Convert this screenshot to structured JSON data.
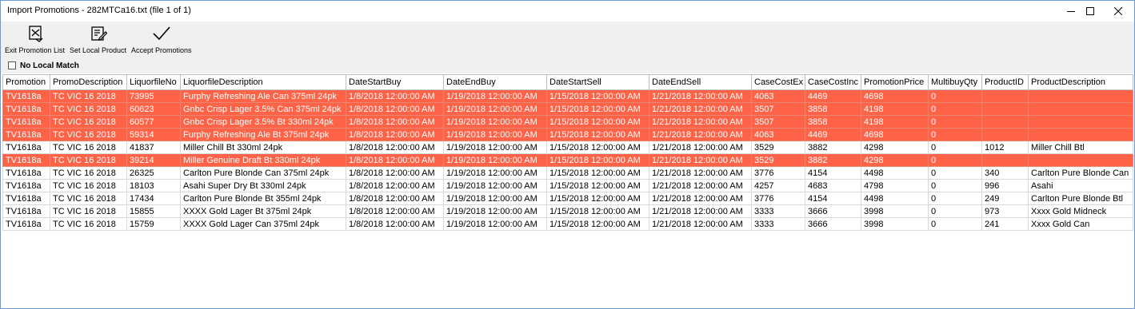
{
  "window": {
    "title": "Import Promotions - 282MTCa16.txt (file 1 of 1)"
  },
  "toolbar": {
    "exit_label": "Exit Promotion List",
    "set_local_label": "Set Local Product",
    "accept_label": "Accept Promotions"
  },
  "filter": {
    "no_local_match_label": "No Local Match",
    "checked": false
  },
  "colors": {
    "highlight_row": "#ff6347",
    "window_border": "#6b9bd1",
    "toolbar_bg": "#f0f0f0"
  },
  "grid": {
    "columns": [
      "Promotion",
      "PromoDescription",
      "LiquorfileNo",
      "LiquorfileDescription",
      "DateStartBuy",
      "DateEndBuy",
      "DateStartSell",
      "DateEndSell",
      "CaseCostEx",
      "CaseCostInc",
      "PromotionPrice",
      "MultibuyQty",
      "ProductID",
      "ProductDescription"
    ],
    "rows": [
      {
        "highlight": true,
        "cells": [
          "TV1618a",
          "TC VIC 16 2018",
          "73995",
          "Furphy Refreshing Ale Can 375ml 24pk",
          "1/8/2018 12:00:00 AM",
          "1/19/2018 12:00:00 AM",
          "1/15/2018 12:00:00 AM",
          "1/21/2018 12:00:00 AM",
          "4063",
          "4469",
          "4698",
          "0",
          "",
          ""
        ]
      },
      {
        "highlight": true,
        "cells": [
          "TV1618a",
          "TC VIC 16 2018",
          "60623",
          "Gnbc Crisp Lager 3.5% Can 375ml 24pk",
          "1/8/2018 12:00:00 AM",
          "1/19/2018 12:00:00 AM",
          "1/15/2018 12:00:00 AM",
          "1/21/2018 12:00:00 AM",
          "3507",
          "3858",
          "4198",
          "0",
          "",
          ""
        ]
      },
      {
        "highlight": true,
        "cells": [
          "TV1618a",
          "TC VIC 16 2018",
          "60577",
          "Gnbc Crisp Lager 3.5% Bt 330ml 24pk",
          "1/8/2018 12:00:00 AM",
          "1/19/2018 12:00:00 AM",
          "1/15/2018 12:00:00 AM",
          "1/21/2018 12:00:00 AM",
          "3507",
          "3858",
          "4198",
          "0",
          "",
          ""
        ]
      },
      {
        "highlight": true,
        "cells": [
          "TV1618a",
          "TC VIC 16 2018",
          "59314",
          "Furphy Refreshing Ale Bt 375ml 24pk",
          "1/8/2018 12:00:00 AM",
          "1/19/2018 12:00:00 AM",
          "1/15/2018 12:00:00 AM",
          "1/21/2018 12:00:00 AM",
          "4063",
          "4469",
          "4698",
          "0",
          "",
          ""
        ]
      },
      {
        "highlight": false,
        "cells": [
          "TV1618a",
          "TC VIC 16 2018",
          "41837",
          "Miller Chill Bt 330ml 24pk",
          "1/8/2018 12:00:00 AM",
          "1/19/2018 12:00:00 AM",
          "1/15/2018 12:00:00 AM",
          "1/21/2018 12:00:00 AM",
          "3529",
          "3882",
          "4298",
          "0",
          "1012",
          "Miller Chill Btl"
        ]
      },
      {
        "highlight": true,
        "cells": [
          "TV1618a",
          "TC VIC 16 2018",
          "39214",
          "Miller Genuine Draft Bt 330ml 24pk",
          "1/8/2018 12:00:00 AM",
          "1/19/2018 12:00:00 AM",
          "1/15/2018 12:00:00 AM",
          "1/21/2018 12:00:00 AM",
          "3529",
          "3882",
          "4298",
          "0",
          "",
          ""
        ]
      },
      {
        "highlight": false,
        "cells": [
          "TV1618a",
          "TC VIC 16 2018",
          "26325",
          "Carlton Pure Blonde Can 375ml 24pk",
          "1/8/2018 12:00:00 AM",
          "1/19/2018 12:00:00 AM",
          "1/15/2018 12:00:00 AM",
          "1/21/2018 12:00:00 AM",
          "3776",
          "4154",
          "4498",
          "0",
          "340",
          "Carlton Pure Blonde Can"
        ]
      },
      {
        "highlight": false,
        "cells": [
          "TV1618a",
          "TC VIC 16 2018",
          "18103",
          "Asahi Super Dry Bt 330ml 24pk",
          "1/8/2018 12:00:00 AM",
          "1/19/2018 12:00:00 AM",
          "1/15/2018 12:00:00 AM",
          "1/21/2018 12:00:00 AM",
          "4257",
          "4683",
          "4798",
          "0",
          "996",
          "Asahi"
        ]
      },
      {
        "highlight": false,
        "cells": [
          "TV1618a",
          "TC VIC 16 2018",
          "17434",
          "Carlton Pure Blonde Bt 355ml 24pk",
          "1/8/2018 12:00:00 AM",
          "1/19/2018 12:00:00 AM",
          "1/15/2018 12:00:00 AM",
          "1/21/2018 12:00:00 AM",
          "3776",
          "4154",
          "4498",
          "0",
          "249",
          "Carlton Pure Blonde Btl"
        ]
      },
      {
        "highlight": false,
        "cells": [
          "TV1618a",
          "TC VIC 16 2018",
          "15855",
          "XXXX Gold Lager Bt 375ml 24pk",
          "1/8/2018 12:00:00 AM",
          "1/19/2018 12:00:00 AM",
          "1/15/2018 12:00:00 AM",
          "1/21/2018 12:00:00 AM",
          "3333",
          "3666",
          "3998",
          "0",
          "973",
          "Xxxx Gold Midneck"
        ]
      },
      {
        "highlight": false,
        "cells": [
          "TV1618a",
          "TC VIC 16 2018",
          "15759",
          "XXXX Gold Lager Can 375ml 24pk",
          "1/8/2018 12:00:00 AM",
          "1/19/2018 12:00:00 AM",
          "1/15/2018 12:00:00 AM",
          "1/21/2018 12:00:00 AM",
          "3333",
          "3666",
          "3998",
          "0",
          "241",
          "Xxxx Gold Can"
        ]
      }
    ]
  }
}
